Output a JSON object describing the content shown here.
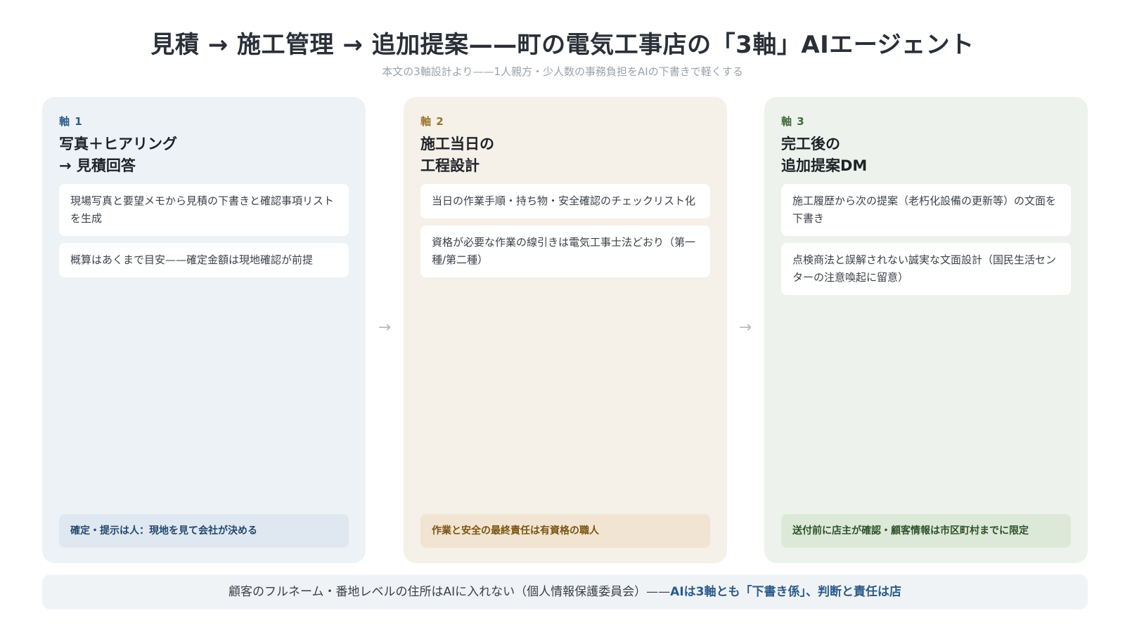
{
  "header": {
    "title": "見積 → 施工管理 → 追加提案——町の電気工事店の「3軸」AIエージェント",
    "subtitle": "本文の3軸設計より——1人親方・少人数の事務負担をAIの下書きで軽くする"
  },
  "colors": {
    "axis1_accent": "#2c5b8a",
    "axis2_accent": "#9c7526",
    "axis3_accent": "#3e6b3c",
    "axis1_bg": "#edf2f7",
    "axis2_bg": "#f5f0e8",
    "axis3_bg": "#edf3ec"
  },
  "flow_arrow": "→",
  "axes": [
    {
      "label": "軸 1",
      "title_line1": "写真＋ヒアリング",
      "title_line2": "→ 見積回答",
      "items": [
        "現場写真と要望メモから見積の下書きと確認事項リストを生成",
        "概算はあくまで目安——確定金額は現地確認が前提"
      ],
      "note": "確定・提示は人：現地を見て会社が決める"
    },
    {
      "label": "軸 2",
      "title_line1": "施工当日の",
      "title_line2": "工程設計",
      "items": [
        "当日の作業手順・持ち物・安全確認のチェックリスト化",
        "資格が必要な作業の線引きは電気工事士法どおり（第一種/第二種）"
      ],
      "note": "作業と安全の最終責任は有資格の職人"
    },
    {
      "label": "軸 3",
      "title_line1": "完工後の",
      "title_line2": "追加提案DM",
      "items": [
        "施工履歴から次の提案（老朽化設備の更新等）の文面を下書き",
        "点検商法と誤解されない誠実な文面設計（国民生活センターの注意喚起に留意）"
      ],
      "note": "送付前に店主が確認・顧客情報は市区町村までに限定"
    }
  ],
  "footer": {
    "text": "顧客のフルネーム・番地レベルの住所はAIに入れない（個人情報保護委員会）——",
    "emphasis": "AIは3軸とも「下書き係」、判断と責任は店"
  }
}
